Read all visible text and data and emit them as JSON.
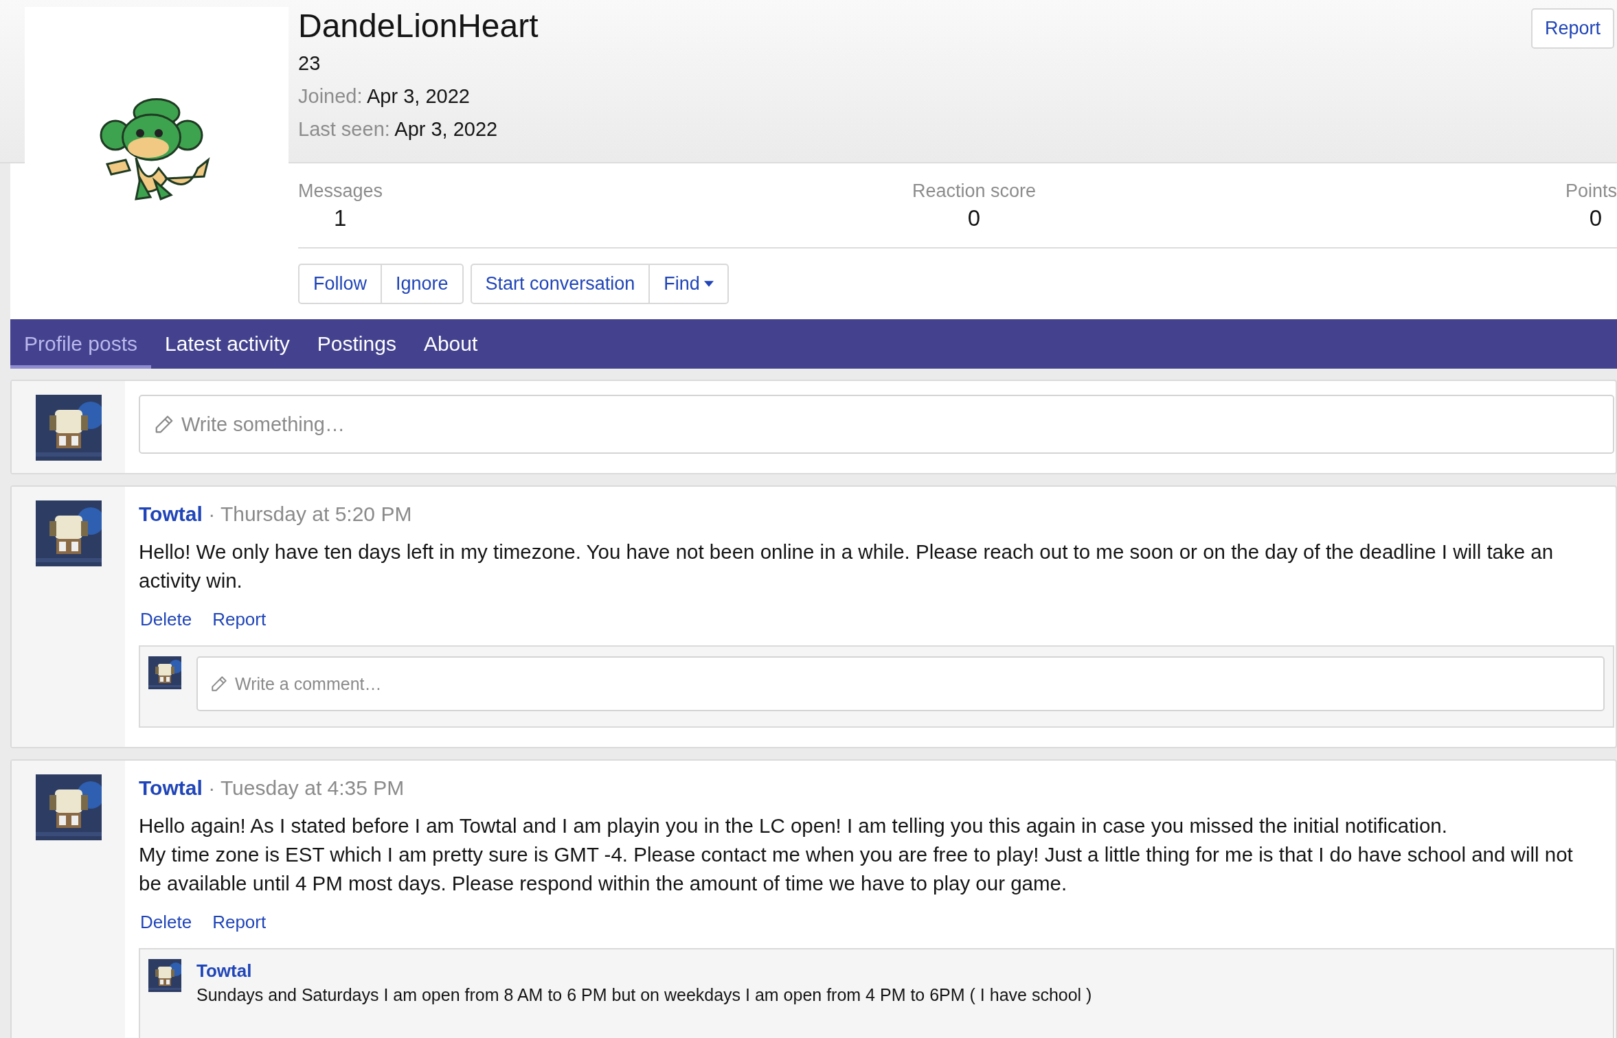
{
  "profile": {
    "name": "DandeLionHeart",
    "title": "23",
    "info": [
      {
        "label": "Joined:",
        "value": "Apr 3, 2022"
      },
      {
        "label": "Last seen:",
        "value": "Apr 3, 2022"
      }
    ],
    "report_button": "Report",
    "stats": [
      {
        "label": "Messages",
        "value": "1"
      },
      {
        "label": "Reaction score",
        "value": "0"
      },
      {
        "label": "Points",
        "value": "0"
      }
    ],
    "button_groups": [
      [
        {
          "label": "Follow",
          "kind": "plain"
        },
        {
          "label": "Ignore",
          "kind": "plain"
        }
      ],
      [
        {
          "label": "Start conversation",
          "kind": "plain"
        },
        {
          "label": "Find",
          "kind": "dropdown"
        }
      ]
    ]
  },
  "tabs": [
    {
      "label": "Profile posts",
      "selected": true
    },
    {
      "label": "Latest activity",
      "selected": false
    },
    {
      "label": "Postings",
      "selected": false
    },
    {
      "label": "About",
      "selected": false
    }
  ],
  "composer": {
    "placeholder": "Write something…"
  },
  "posts": [
    {
      "author": "Towtal",
      "time": "· Thursday at 5:20 PM",
      "paragraphs": [
        "Hello! We only have ten days left in my timezone. You have not been online in a while. Please reach out to me soon or on the day of the deadline I will take an activity win."
      ],
      "actions": [
        "Delete",
        "Report"
      ],
      "comment_box": {
        "placeholder": "Write a comment…"
      }
    },
    {
      "author": "Towtal",
      "time": "· Tuesday at 4:35 PM",
      "paragraphs": [
        "Hello again! As I stated before I am Towtal and I am playin you in the LC open! I am telling you this again in case you missed the initial notification.",
        "My time zone is EST which I am pretty sure is GMT -4. Please contact me when you are free to play! Just a little thing for me is that I do have school and will not be available until 4 PM most days. Please respond within the amount of time we have to play our game."
      ],
      "actions": [
        "Delete",
        "Report"
      ],
      "comments": [
        {
          "author": "Towtal",
          "text": "Sundays and Saturdays I am open from 8 AM to 6 PM but on weekdays I am open from 4 PM to 6PM ( I have school )"
        }
      ]
    }
  ]
}
